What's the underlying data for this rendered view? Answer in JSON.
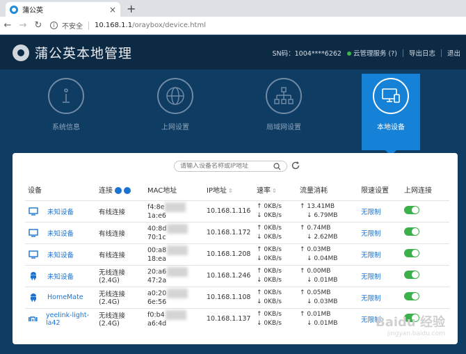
{
  "browser": {
    "tab_title": "蒲公英",
    "tab_close": "×",
    "new_tab": "+",
    "insecure_label": "不安全",
    "url_host": "10.168.1.1",
    "url_path": "/oraybox/device.html"
  },
  "header": {
    "title": "蒲公英本地管理",
    "sn": "SN码：1004****6262",
    "cloud_service": "云管理服务 (?)",
    "export_log": "导出日志",
    "logout": "退出"
  },
  "nav": [
    {
      "label": "系统信息",
      "icon": "info-icon",
      "active": false
    },
    {
      "label": "上网设置",
      "icon": "globe-icon",
      "active": false
    },
    {
      "label": "局域网设置",
      "icon": "network-icon",
      "active": false
    },
    {
      "label": "本地设备",
      "icon": "devices-icon",
      "active": true
    }
  ],
  "search": {
    "placeholder": "请输入设备名称或IP地址"
  },
  "table": {
    "headers": {
      "device": "设备",
      "connection": "连接",
      "mac": "MAC地址",
      "ip": "IP地址",
      "speed": "速率",
      "traffic": "流量消耗",
      "limit": "限速设置",
      "online": "上网连接"
    },
    "rows": [
      {
        "icon": "monitor-icon",
        "name": "未知设备",
        "connection": "有线连接",
        "mac_prefix": "f4:8e",
        "mac_suffix": "1a:e6",
        "ip": "10.168.1.116",
        "up_speed": "↑ 0KB/s",
        "down_speed": "↓ 0KB/s",
        "up_traffic": "↑ 13.41MB",
        "down_traffic": "↓ 6.79MB",
        "limit": "无限制",
        "online": true
      },
      {
        "icon": "monitor-icon",
        "name": "未知设备",
        "connection": "有线连接",
        "mac_prefix": "40:8d",
        "mac_suffix": "70:1c",
        "ip": "10.168.1.172",
        "up_speed": "↑ 0KB/s",
        "down_speed": "↓ 0KB/s",
        "up_traffic": "↑ 0.74MB",
        "down_traffic": "↓ 2.62MB",
        "limit": "无限制",
        "online": true
      },
      {
        "icon": "monitor-icon",
        "name": "未知设备",
        "connection": "有线连接",
        "mac_prefix": "00:a8",
        "mac_suffix": "18:ea",
        "ip": "10.168.1.208",
        "up_speed": "↑ 0KB/s",
        "down_speed": "↓ 0KB/s",
        "up_traffic": "↑ 0.03MB",
        "down_traffic": "↓ 0.04MB",
        "limit": "无限制",
        "online": true
      },
      {
        "icon": "android-icon",
        "name": "未知设备",
        "connection": "无线连接(2.4G)",
        "mac_prefix": "20:a6",
        "mac_suffix": "47:2a",
        "ip": "10.168.1.246",
        "up_speed": "↑ 0KB/s",
        "down_speed": "↓ 0KB/s",
        "up_traffic": "↑ 0.00MB",
        "down_traffic": "↓ 0.01MB",
        "limit": "无限制",
        "online": true
      },
      {
        "icon": "android-icon",
        "name": "HomeMate",
        "connection": "无线连接(2.4G)",
        "mac_prefix": "a0:20",
        "mac_suffix": "6e:56",
        "ip": "10.168.1.108",
        "up_speed": "↑ 0KB/s",
        "down_speed": "↓ 0KB/s",
        "up_traffic": "↑ 0.05MB",
        "down_traffic": "↓ 0.03MB",
        "limit": "无限制",
        "online": true
      },
      {
        "icon": "mi-icon",
        "name": "yeelink-light-la42",
        "connection": "无线连接(2.4G)",
        "mac_prefix": "f0:b4",
        "mac_suffix": "a6:4d",
        "ip": "10.168.1.137",
        "up_speed": "↑ 0KB/s",
        "down_speed": "↓ 0KB/s",
        "up_traffic": "↑ 0.01MB",
        "down_traffic": "↓ 0.01MB",
        "limit": "无限制",
        "online": true
      }
    ]
  },
  "watermark": {
    "brand": "Baidu 经验",
    "url": "jingyan.baidu.com"
  },
  "colors": {
    "accent": "#1582d8",
    "header_bg": "#0d2a44",
    "page_bg": "#0f3c63",
    "toggle_on": "#3cb14a",
    "link": "#1a73d0"
  }
}
